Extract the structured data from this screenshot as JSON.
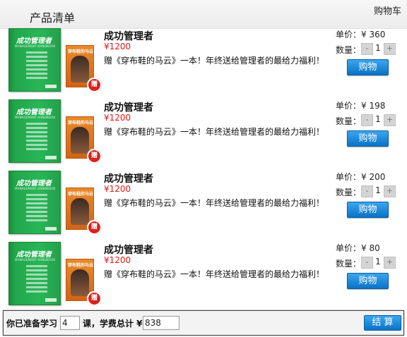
{
  "header": {
    "title": "产品清单",
    "cart": "购物车"
  },
  "book": {
    "cover_title": "成功管理者",
    "cover_subtitle": "MANAGEMENT HANDBOOK",
    "gift_title": "穿布鞋的马云",
    "gift_badge": "赠"
  },
  "items": [
    {
      "name": "成功管理者",
      "price": "¥1200",
      "desc": "赠《穿布鞋的马云》一本！年终送给管理者的最给力福利！",
      "unit_label": "单价：",
      "unit_price": "¥ 360",
      "qty_label": "数量：",
      "qty": "1",
      "buy": "购物"
    },
    {
      "name": "成功管理者",
      "price": "¥1200",
      "desc": "赠《穿布鞋的马云》一本！年终送给管理者的最给力福利！",
      "unit_label": "单价：",
      "unit_price": "¥ 198",
      "qty_label": "数量：",
      "qty": "1",
      "buy": "购物"
    },
    {
      "name": "成功管理者",
      "price": "¥1200",
      "desc": "赠《穿布鞋的马云》一本！年终送给管理者的最给力福利！",
      "unit_label": "单价：",
      "unit_price": "¥ 200",
      "qty_label": "数量：",
      "qty": "1",
      "buy": "购物"
    },
    {
      "name": "成功管理者",
      "price": "¥1200",
      "desc": "赠《穿布鞋的马云》一本！年终送给管理者的最给力福利！",
      "unit_label": "单价：",
      "unit_price": "¥ 80",
      "qty_label": "数量：",
      "qty": "1",
      "buy": "购物"
    }
  ],
  "stepper": {
    "minus": "-",
    "plus": "+"
  },
  "footer": {
    "label_prefix": "你已准备学习",
    "count": "4",
    "label_mid": "课，学费总计 ¥",
    "total": "838",
    "checkout": "结 算"
  },
  "colors": {
    "accent_blue": "#0b72c6",
    "price_red": "#e4161a",
    "cover_green": "#29b657"
  }
}
